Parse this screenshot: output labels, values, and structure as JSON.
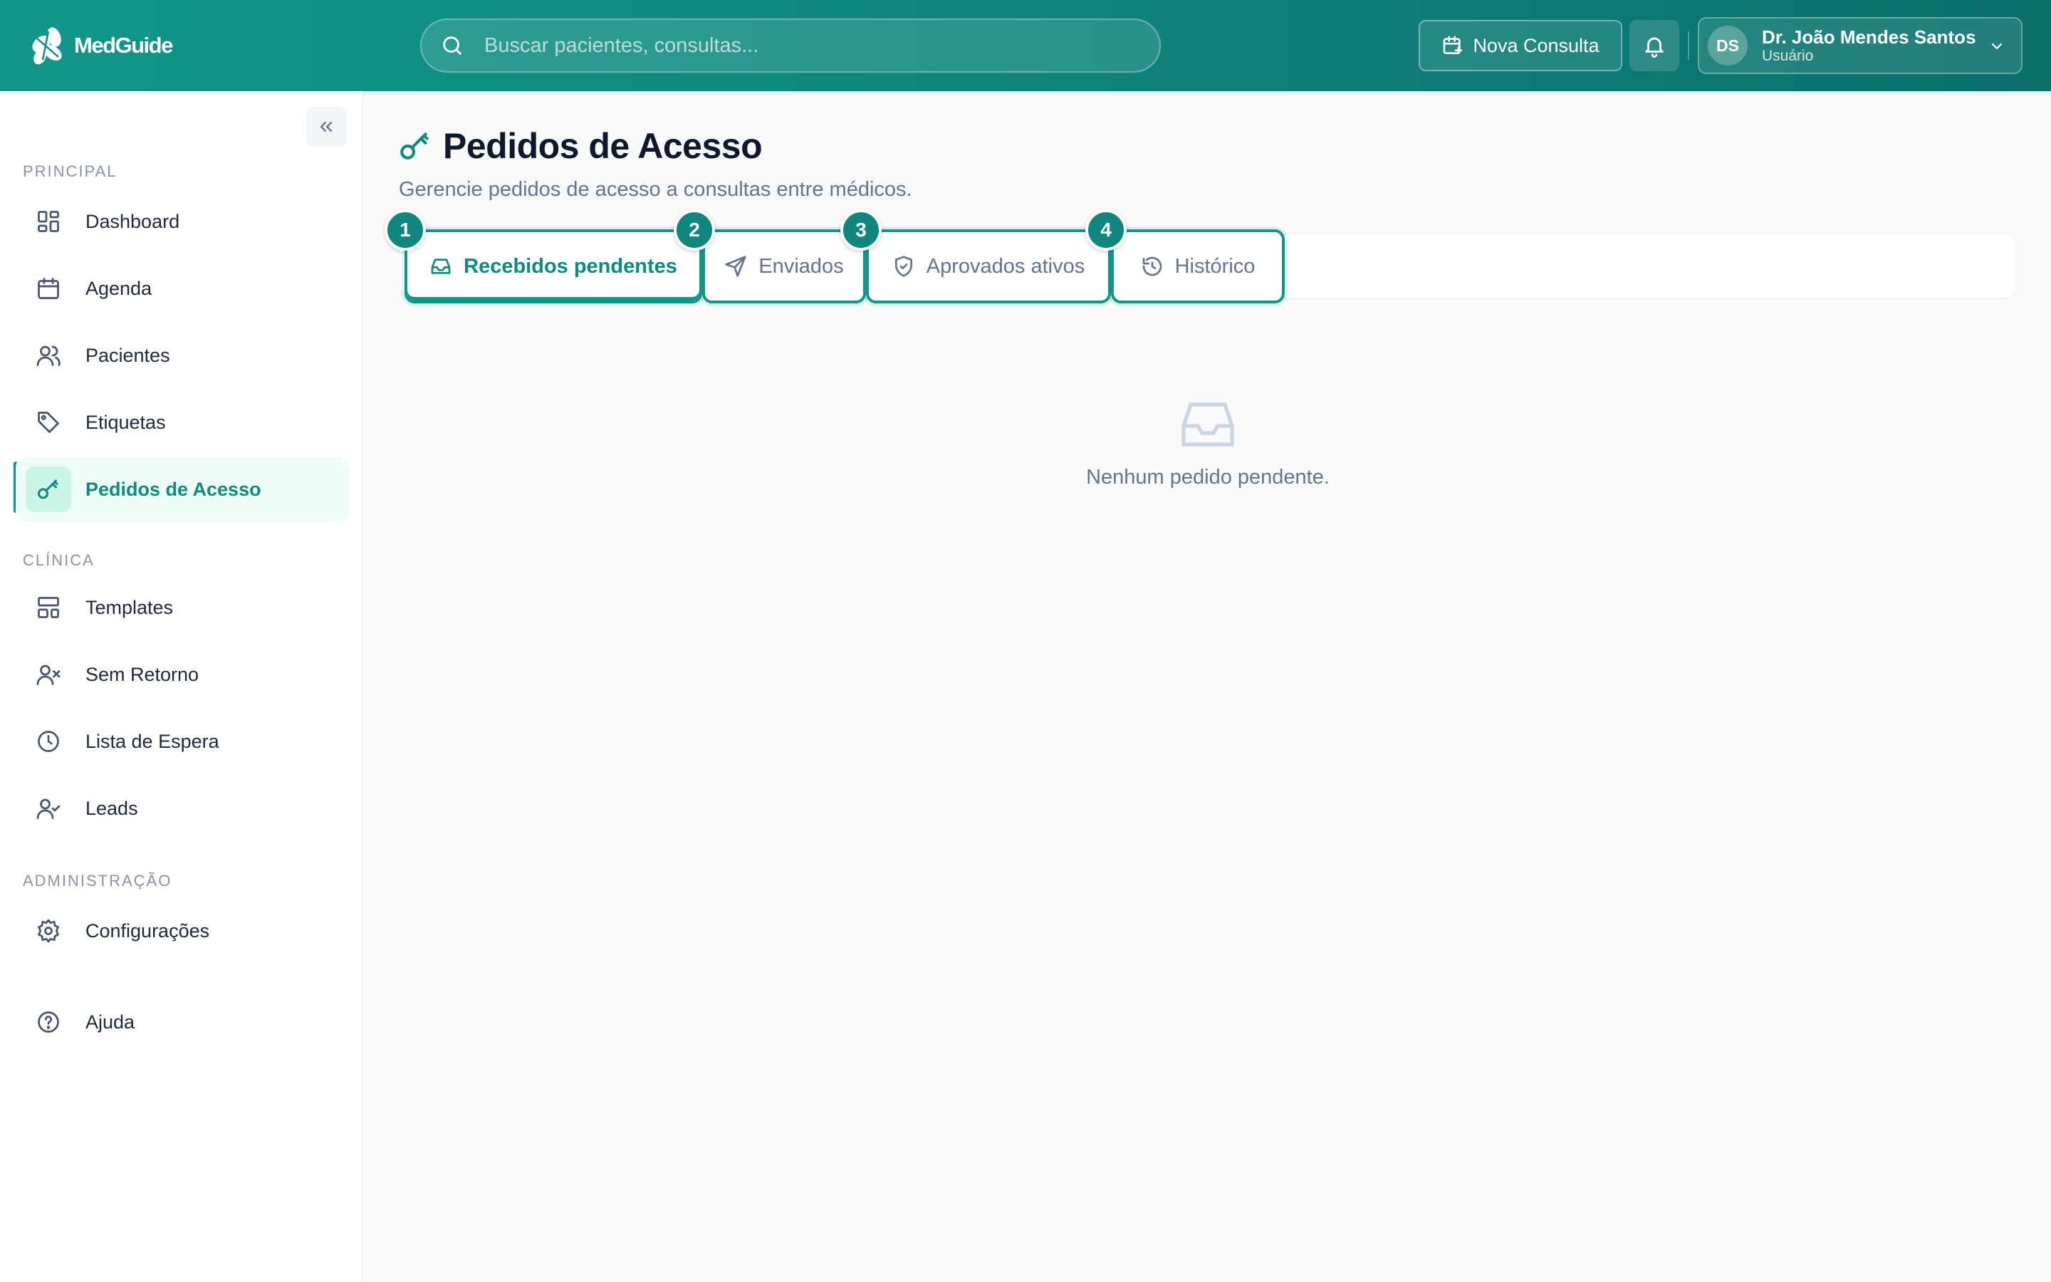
{
  "header": {
    "logo_text": "MedGuide",
    "search_placeholder": "Buscar pacientes, consultas...",
    "new_consult_label": "Nova Consulta",
    "user": {
      "initials": "DS",
      "name": "Dr. João Mendes Santos",
      "role": "Usuário"
    }
  },
  "sidebar": {
    "sections": [
      {
        "label": "PRINCIPAL",
        "items": [
          {
            "label": "Dashboard",
            "icon": "dashboard-icon"
          },
          {
            "label": "Agenda",
            "icon": "calendar-icon"
          },
          {
            "label": "Pacientes",
            "icon": "users-icon"
          },
          {
            "label": "Etiquetas",
            "icon": "tag-icon"
          },
          {
            "label": "Pedidos de Acesso",
            "icon": "key-icon",
            "active": true
          }
        ]
      },
      {
        "label": "CLÍNICA",
        "items": [
          {
            "label": "Templates",
            "icon": "layout-icon"
          },
          {
            "label": "Sem Retorno",
            "icon": "user-x-icon"
          },
          {
            "label": "Lista de Espera",
            "icon": "clock-icon"
          },
          {
            "label": "Leads",
            "icon": "user-check-icon"
          }
        ]
      },
      {
        "label": "ADMINISTRAÇÃO",
        "items": [
          {
            "label": "Configurações",
            "icon": "gear-icon"
          }
        ]
      }
    ],
    "help_label": "Ajuda"
  },
  "main": {
    "title": "Pedidos de Acesso",
    "subtitle": "Gerencie pedidos de acesso a consultas entre médicos.",
    "tabs": [
      {
        "label": "Recebidos pendentes",
        "badge": "1",
        "icon": "inbox-icon",
        "active": true
      },
      {
        "label": "Enviados",
        "badge": "2",
        "icon": "send-icon"
      },
      {
        "label": "Aprovados ativos",
        "badge": "3",
        "icon": "shield-check-icon"
      },
      {
        "label": "Histórico",
        "badge": "4",
        "icon": "history-icon"
      }
    ],
    "empty_message": "Nenhum pedido pendente."
  },
  "colors": {
    "primary": "#13968a",
    "primary_dark": "#0b6f6a",
    "active_bg": "#effdf9",
    "text": "#0f172a",
    "muted": "#64748b"
  }
}
